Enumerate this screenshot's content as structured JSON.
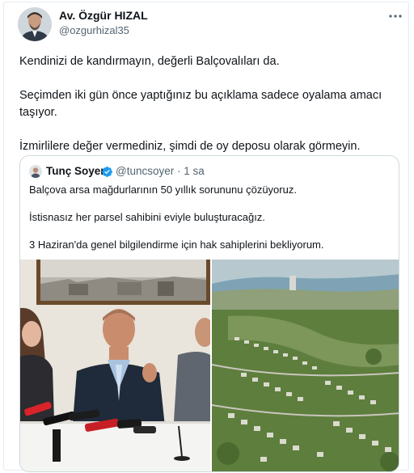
{
  "author": {
    "name": "Av. Özgür HIZAL",
    "handle": "@ozgurhizal35",
    "avatar_icon": "person-avatar-icon"
  },
  "tweet": {
    "paragraphs": [
      "Kendinizi de kandırmayın, değerli Balçovalıları da.",
      "Seçimden iki gün önce yaptığınız bu açıklama sadece oyalama amacı taşıyor.",
      "İzmirlilere değer vermediniz, şimdi de oy deposu olarak görmeyin."
    ]
  },
  "quote": {
    "name": "Tunç Soyer",
    "handle_time": "@tuncsoyer · 1 sa",
    "verified_color": "#1d9bf0",
    "paragraphs": [
      "Balçova arsa mağdurlarının 50 yıllık sorununu çözüyoruz.",
      "İstisnasız her parsel sahibini eviyle buluşturacağız.",
      "3 Haziran'da genel bilgilendirme için hak sahiplerini bekliyorum."
    ],
    "media": [
      "press-conference-photo",
      "aerial-city-rendering-photo"
    ]
  },
  "colors": {
    "text_primary": "#0f1419",
    "text_secondary": "#536471",
    "border": "#cfd9de"
  }
}
